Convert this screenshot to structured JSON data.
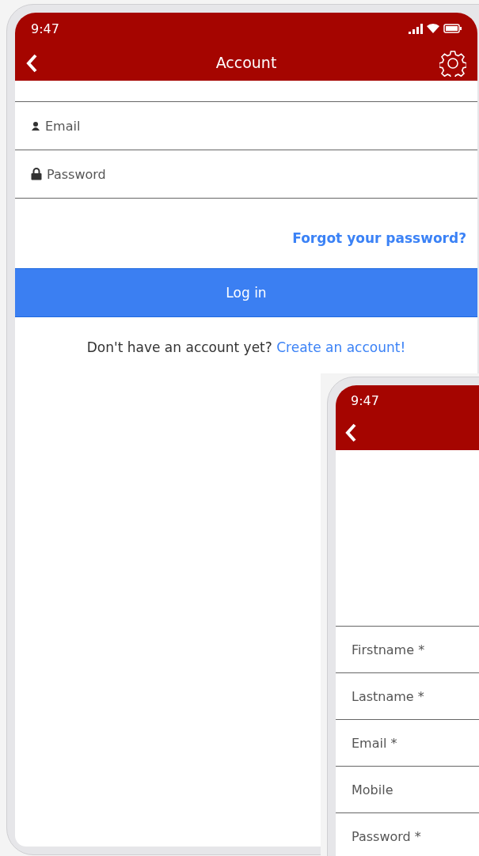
{
  "login_screen": {
    "status_bar": {
      "time": "9:47"
    },
    "header": {
      "title": "Account"
    },
    "fields": [
      {
        "kind": "email",
        "placeholder": "Email"
      },
      {
        "kind": "password",
        "placeholder": "Password"
      }
    ],
    "forgot_link": "Forgot your password?",
    "login_button": "Log in",
    "signup_prompt": {
      "text": "Don't have an account yet?",
      "link": "Create an account!"
    }
  },
  "register_screen": {
    "status_bar": {
      "time": "9:47"
    },
    "fields": [
      {
        "placeholder": "Firstname *"
      },
      {
        "placeholder": "Lastname *"
      },
      {
        "placeholder": "Email *"
      },
      {
        "placeholder": "Mobile"
      },
      {
        "placeholder": "Password *"
      }
    ]
  }
}
